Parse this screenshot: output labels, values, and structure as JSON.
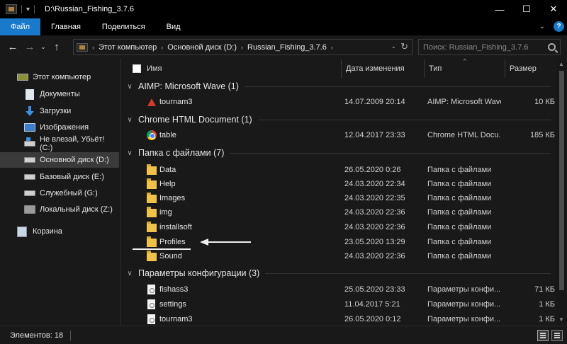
{
  "window": {
    "title": "D:\\Russian_Fishing_3.7.6",
    "controls": {
      "minimize": "—",
      "maximize": "☐",
      "close": "✕"
    }
  },
  "ribbon": {
    "tabs": [
      {
        "label": "Файл",
        "active": true
      },
      {
        "label": "Главная"
      },
      {
        "label": "Поделиться"
      },
      {
        "label": "Вид"
      }
    ],
    "help": "?"
  },
  "nav": {
    "back": "←",
    "forward": "→",
    "recent": "⌄",
    "up": "↑",
    "breadcrumb": [
      "Этот компьютер",
      "Основной диск (D:)",
      "Russian_Fishing_3.7.6"
    ],
    "search_placeholder": "Поиск: Russian_Fishing_3.7.6"
  },
  "sidebar": {
    "items": [
      {
        "label": "Этот компьютер",
        "icon": "computer-icon"
      },
      {
        "label": "Документы",
        "icon": "documents-icon"
      },
      {
        "label": "Загрузки",
        "icon": "downloads-icon"
      },
      {
        "label": "Изображения",
        "icon": "pictures-icon"
      },
      {
        "label": "Не влезай, Убьёт! (C:)",
        "icon": "drive-icon"
      },
      {
        "label": "Основной диск (D:)",
        "icon": "drive-icon",
        "selected": true
      },
      {
        "label": "Базовый диск (E:)",
        "icon": "drive-icon"
      },
      {
        "label": "Служебный (G:)",
        "icon": "drive-icon"
      },
      {
        "label": "Локальный диск (Z:)",
        "icon": "drive-icon"
      },
      {
        "label": "Корзина",
        "icon": "recycle-bin-icon"
      }
    ]
  },
  "columns": {
    "name": "Имя",
    "date": "Дата изменения",
    "type": "Тип",
    "size": "Размер"
  },
  "groups": [
    {
      "title": "AIMP: Microsoft Wave (1)",
      "rows": [
        {
          "name": "tournam3",
          "date": "14.07.2009 20:14",
          "type": "AIMP: Microsoft Wave",
          "size": "10 КБ",
          "icon": "aimp-icon"
        }
      ]
    },
    {
      "title": "Chrome HTML Document (1)",
      "rows": [
        {
          "name": "table",
          "date": "12.04.2017 23:33",
          "type": "Chrome HTML Docu...",
          "size": "185 КБ",
          "icon": "chrome-icon"
        }
      ]
    },
    {
      "title": "Папка с файлами (7)",
      "rows": [
        {
          "name": "Data",
          "date": "26.05.2020 0:26",
          "type": "Папка с файлами",
          "size": "",
          "icon": "folder-icon"
        },
        {
          "name": "Help",
          "date": "24.03.2020 22:34",
          "type": "Папка с файлами",
          "size": "",
          "icon": "folder-icon"
        },
        {
          "name": "Images",
          "date": "24.03.2020 22:35",
          "type": "Папка с файлами",
          "size": "",
          "icon": "folder-icon"
        },
        {
          "name": "img",
          "date": "24.03.2020 22:36",
          "type": "Папка с файлами",
          "size": "",
          "icon": "folder-icon"
        },
        {
          "name": "installsoft",
          "date": "24.03.2020 22:36",
          "type": "Папка с файлами",
          "size": "",
          "icon": "folder-icon"
        },
        {
          "name": "Profiles",
          "date": "23.05.2020 13:29",
          "type": "Папка с файлами",
          "size": "",
          "icon": "folder-icon"
        },
        {
          "name": "Sound",
          "date": "24.03.2020 22:36",
          "type": "Папка с файлами",
          "size": "",
          "icon": "folder-icon"
        }
      ]
    },
    {
      "title": "Параметры конфигурации (3)",
      "rows": [
        {
          "name": "fishass3",
          "date": "25.05.2020 23:33",
          "type": "Параметры конфи...",
          "size": "71 КБ",
          "icon": "config-file-icon"
        },
        {
          "name": "settings",
          "date": "11.04.2017 5:21",
          "type": "Параметры конфи...",
          "size": "1 КБ",
          "icon": "config-file-icon"
        },
        {
          "name": "tournam3",
          "date": "26.05.2020 0:12",
          "type": "Параметры конфи...",
          "size": "1 КБ",
          "icon": "config-file-icon"
        }
      ]
    }
  ],
  "status": {
    "items_count": "Элементов: 18"
  },
  "colors": {
    "accent": "#1979ca",
    "background": "#191919",
    "titlebar": "#000000",
    "folder": "#f0c24a"
  }
}
